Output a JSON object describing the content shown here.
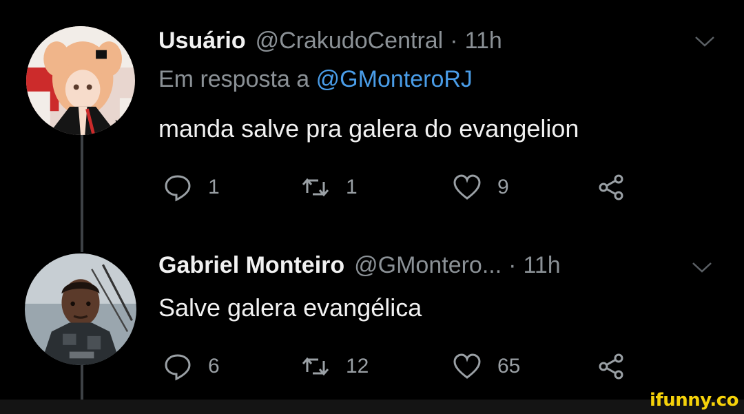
{
  "tweets": [
    {
      "display_name": "Usuário",
      "handle": "@CrakudoCentral",
      "separator": "·",
      "time": "11h",
      "reply_prefix": "Em resposta a",
      "reply_mention": "@GMonteroRJ",
      "text": "manda salve pra galera do evangelion",
      "replies": "1",
      "retweets": "1",
      "likes": "9",
      "avatar_icon": "anime-girl-avatar"
    },
    {
      "display_name": "Gabriel Monteiro",
      "handle": "@GMontero...",
      "separator": "·",
      "time": "11h",
      "text": "Salve galera evangélica",
      "replies": "6",
      "retweets": "12",
      "likes": "65",
      "avatar_icon": "man-photo-avatar"
    }
  ],
  "watermark": "ifunny.co",
  "colors": {
    "background": "#000000",
    "text": "#f1f1f1",
    "muted": "#8b9196",
    "mention": "#4a9de8",
    "watermark": "#f5d20a"
  },
  "icons": {
    "reply": "reply-icon",
    "retweet": "retweet-icon",
    "like": "heart-icon",
    "share": "share-icon",
    "menu": "chevron-down-icon"
  }
}
